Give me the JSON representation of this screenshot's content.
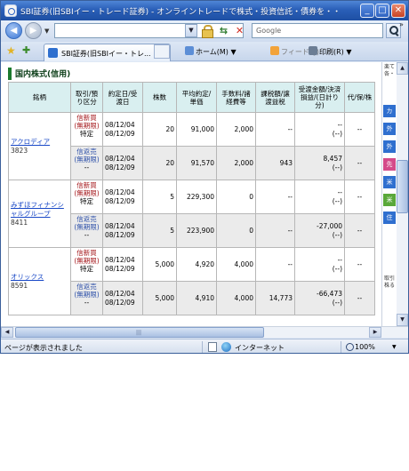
{
  "window": {
    "title": "SBI証券(旧SBIイー・トレード証券) - オンライントレードで株式・投資信託・債券を・・ - Wind...",
    "controls": {
      "minimize": "_",
      "maximize": "□",
      "close": "✕"
    }
  },
  "toolbar": {
    "address_placeholder": "",
    "search_placeholder": "Google",
    "more": "»"
  },
  "tabs": {
    "active_label": "SBI証券(旧SBIイー・トレ...",
    "home_label": "ホーム(M)",
    "feed_label": "フィード (J)",
    "print_label": "印刷(R)"
  },
  "section": {
    "title": "国内株式(信用)"
  },
  "table": {
    "headers": {
      "name": "銘柄",
      "kind": "取引/預り区分",
      "date": "約定日/受渡日",
      "qty": "株数",
      "avg": "平均約定/単価",
      "fee": "手数料/諸経費等",
      "tax": "課税額/譲渡益税",
      "amount": "受渡金額/決済損益/(日計り分)",
      "proxy": "代/保/株"
    },
    "groups": [
      {
        "name": "アクロディア",
        "code": "3823",
        "rows": [
          {
            "kind": "信新買",
            "term": "(無期限)",
            "note": "特定",
            "trade_date": "08/12/04",
            "settle_date": "08/12/09",
            "qty": "20",
            "avg": "91,000",
            "fee": "2,000",
            "tax": "--",
            "amount": "--",
            "pl": "(--)",
            "proxy": "--"
          },
          {
            "kind": "信返売",
            "term": "(無期限)",
            "note": "--",
            "trade_date": "08/12/04",
            "settle_date": "08/12/09",
            "qty": "20",
            "avg": "91,570",
            "fee": "2,000",
            "tax": "943",
            "amount": "8,457",
            "pl": "(--)",
            "proxy": "--"
          }
        ]
      },
      {
        "name": "みずほフィナンシャルグループ",
        "code": "8411",
        "rows": [
          {
            "kind": "信新買",
            "term": "(無期限)",
            "note": "特定",
            "trade_date": "08/12/04",
            "settle_date": "08/12/09",
            "qty": "5",
            "avg": "229,300",
            "fee": "0",
            "tax": "--",
            "amount": "--",
            "pl": "(--)",
            "proxy": "--"
          },
          {
            "kind": "信返売",
            "term": "(無期限)",
            "note": "--",
            "trade_date": "08/12/04",
            "settle_date": "08/12/09",
            "qty": "5",
            "avg": "223,900",
            "fee": "0",
            "tax": "--",
            "amount": "-27,000",
            "pl": "(--)",
            "proxy": "--"
          }
        ]
      },
      {
        "name": "オリックス",
        "code": "8591",
        "rows": [
          {
            "kind": "信新買",
            "term": "(無期限)",
            "note": "特定",
            "trade_date": "08/12/04",
            "settle_date": "08/12/09",
            "qty": "5,000",
            "avg": "4,920",
            "fee": "4,000",
            "tax": "--",
            "amount": "--",
            "pl": "(--)",
            "proxy": "--"
          },
          {
            "kind": "信返売",
            "term": "(無期限)",
            "note": "--",
            "trade_date": "08/12/04",
            "settle_date": "08/12/09",
            "qty": "5,000",
            "avg": "4,910",
            "fee": "4,000",
            "tax": "14,773",
            "amount": "-66,473",
            "pl": "(--)",
            "proxy": "--"
          }
        ]
      }
    ]
  },
  "side_panel": {
    "chips": [
      {
        "label": "カ",
        "color": "#2f6fcf"
      },
      {
        "label": "外",
        "color": "#2f6fcf"
      },
      {
        "label": "外",
        "color": "#2f6fcf"
      },
      {
        "label": "先",
        "color": "#d44a8a"
      },
      {
        "label": "米",
        "color": "#2f6fcf"
      },
      {
        "label": "米",
        "color": "#5aa83a"
      },
      {
        "label": "住",
        "color": "#2f6fcf"
      }
    ],
    "top_text": "楽て各・",
    "bottom_text": "取引株る"
  },
  "statusbar": {
    "text": "ページが表示されました",
    "zone": "インターネット",
    "zoom": "100%"
  }
}
